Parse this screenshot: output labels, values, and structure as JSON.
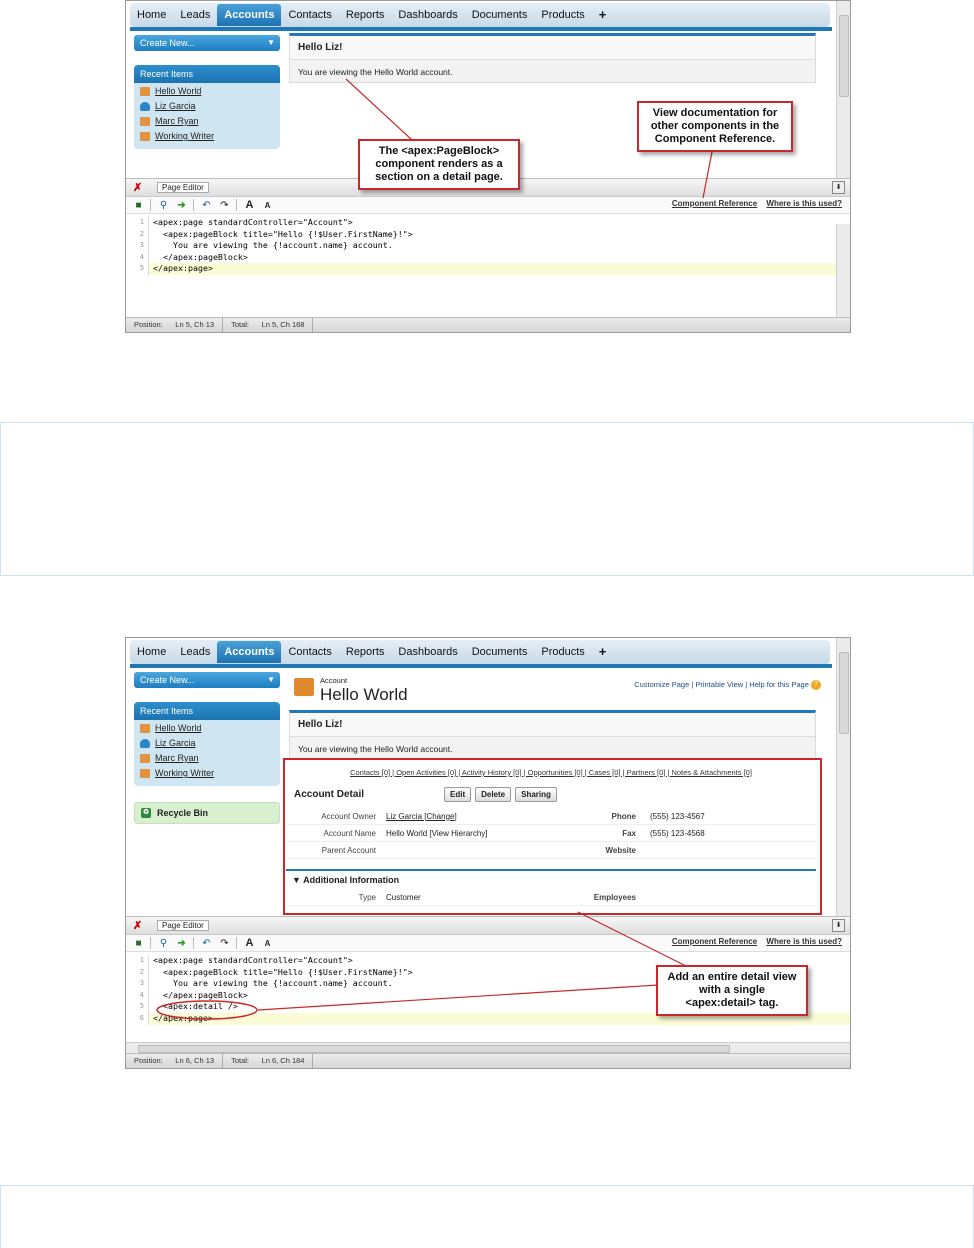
{
  "nav": {
    "tabs": [
      "Home",
      "Leads",
      "Accounts",
      "Contacts",
      "Reports",
      "Dashboards",
      "Documents",
      "Products",
      "+"
    ],
    "selected": "Accounts"
  },
  "sidebar": {
    "create_new": "Create New...",
    "create_new_arrow": "▼",
    "recent_title": "Recent Items",
    "recent_items": [
      "Hello World",
      "Liz Garcia",
      "Marc Ryan",
      "Working Writer"
    ],
    "recycle_bin": "Recycle Bin"
  },
  "pageblock": {
    "title": "Hello Liz!",
    "body": "You are viewing the Hello World account."
  },
  "editor": {
    "tab_label": "Page Editor",
    "links": {
      "component_reference": "Component Reference",
      "where_used": "Where is this used?"
    }
  },
  "shot1": {
    "code_lines": [
      "<apex:page standardController=\"Account\">",
      "  <apex:pageBlock title=\"Hello {!$User.FirstName}!\">",
      "    You are viewing the {!account.name} account.",
      "  </apex:pageBlock>",
      "</apex:page>"
    ],
    "line_numbers": [
      "1",
      "2",
      "3",
      "4",
      "5"
    ],
    "status": {
      "position_label": "Position:",
      "position_value": "Ln 5, Ch 13",
      "total_label": "Total:",
      "total_value": "Ln 5, Ch 168"
    },
    "callout_pageblock": "The <apex:PageBlock> component renders as a section on a detail page.",
    "callout_docs": "View documentation for other components in the Component Reference."
  },
  "shot2": {
    "account_label": "Account",
    "account_name": "Hello World",
    "top_links": "Customize Page | Printable View | Help for this Page",
    "related_lists": "Contacts [0]  |  Open Activities [0]  |  Activity History [0]  |  Opportunities [0]  |  Cases [0]  |  Partners [0]  |  Notes & Attachments [0]",
    "detail_title": "Account Detail",
    "buttons": [
      "Edit",
      "Delete",
      "Sharing"
    ],
    "fields": [
      {
        "label": "Account Owner",
        "value": "Liz Garcia [Change]",
        "label2": "Phone",
        "value2": "(555) 123-4567"
      },
      {
        "label": "Account Name",
        "value": "Hello World [View Hierarchy]",
        "label2": "Fax",
        "value2": "(555) 123-4568"
      },
      {
        "label": "Parent Account",
        "value": "",
        "label2": "Website",
        "value2": ""
      }
    ],
    "additional_info": "▼ Additional Information",
    "type_label": "Type",
    "type_value": "Customer",
    "employees_label": "Employees",
    "code_lines": [
      "<apex:page standardController=\"Account\">",
      "  <apex:pageBlock title=\"Hello {!$User.FirstName}!\">",
      "    You are viewing the {!account.name} account.",
      "  </apex:pageBlock>",
      "  <apex:detail />",
      "</apex:page>"
    ],
    "line_numbers": [
      "1",
      "2",
      "3",
      "4",
      "5",
      "6"
    ],
    "status": {
      "position_label": "Position:",
      "position_value": "Ln 6, Ch 13",
      "total_label": "Total:",
      "total_value": "Ln 6, Ch 184"
    },
    "callout_detail": "Add an entire detail view with a single <apex:detail> tag."
  },
  "colors": {
    "accent": "#1f77b4",
    "callout_border": "#c8282a"
  },
  "icons": [
    "save-icon",
    "search-icon",
    "go-icon",
    "undo-icon",
    "redo-icon",
    "font-larger-icon",
    "font-smaller-icon",
    "close-icon",
    "collapse-icon",
    "folder-icon",
    "help-icon",
    "recycle-icon"
  ]
}
